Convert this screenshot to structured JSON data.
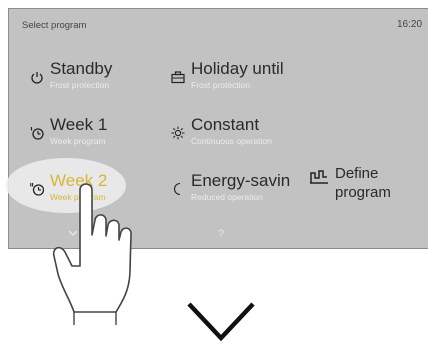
{
  "header": {
    "title": "Select program",
    "time": "16:20"
  },
  "options": {
    "standby": {
      "label": "Standby",
      "sub": "Frost protection",
      "icon": "power-icon"
    },
    "holiday": {
      "label": "Holiday until",
      "sub": "Frost protection",
      "icon": "suitcase-icon"
    },
    "week1": {
      "label": "Week 1",
      "sub": "Week program",
      "icon": "clock-1-icon"
    },
    "constant": {
      "label": "Constant",
      "sub": "Continuous operation",
      "icon": "sun-icon"
    },
    "week2": {
      "label": "Week 2",
      "sub": "Week program",
      "icon": "clock-2-icon"
    },
    "energy": {
      "label": "Energy-savin",
      "sub": "Reduced operation",
      "icon": "moon-icon"
    },
    "define": {
      "label_line1": "Define",
      "label_line2": "program",
      "icon": "define-program-icon"
    }
  },
  "footer": {
    "help": "?"
  },
  "colors": {
    "screen_bg": "#c2c2c2",
    "selected_text": "#d6b637"
  }
}
